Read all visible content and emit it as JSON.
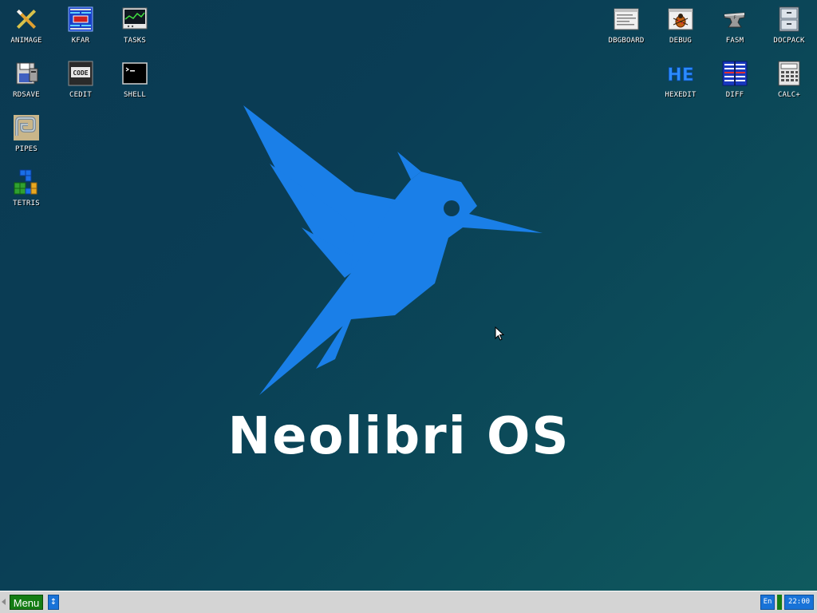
{
  "desktop": {
    "logo_text": "Neolibri OS",
    "colors": {
      "bird": "#1a7fe8",
      "background_from": "#0b3a52",
      "background_to": "#0f5a5e"
    },
    "icons_left": [
      {
        "label": "ANIMAGE",
        "icon": "pencil-ruler-icon"
      },
      {
        "label": "KFAR",
        "icon": "file-manager-icon"
      },
      {
        "label": "TASKS",
        "icon": "system-monitor-icon"
      },
      {
        "label": "RDSAVE",
        "icon": "ramdisk-save-icon"
      },
      {
        "label": "CEDIT",
        "icon": "code-editor-icon"
      },
      {
        "label": "SHELL",
        "icon": "terminal-icon"
      },
      {
        "label": "PIPES",
        "icon": "pipes-game-icon"
      },
      {
        "label": "TETRIS",
        "icon": "tetris-icon"
      }
    ],
    "icons_right": [
      {
        "label": "DBGBOARD",
        "icon": "debug-board-icon"
      },
      {
        "label": "DEBUG",
        "icon": "debugger-bug-icon"
      },
      {
        "label": "FASM",
        "icon": "assembler-anvil-icon"
      },
      {
        "label": "DOCPACK",
        "icon": "filing-cabinet-icon"
      },
      {
        "label": "HEXEDIT",
        "icon": "hex-editor-icon"
      },
      {
        "label": "DIFF",
        "icon": "diff-compare-icon"
      },
      {
        "label": "CALC+",
        "icon": "calculator-icon"
      }
    ]
  },
  "taskbar": {
    "menu_label": "Menu",
    "switch_label": "↕",
    "lang_label": "En",
    "clock": "22:00"
  }
}
